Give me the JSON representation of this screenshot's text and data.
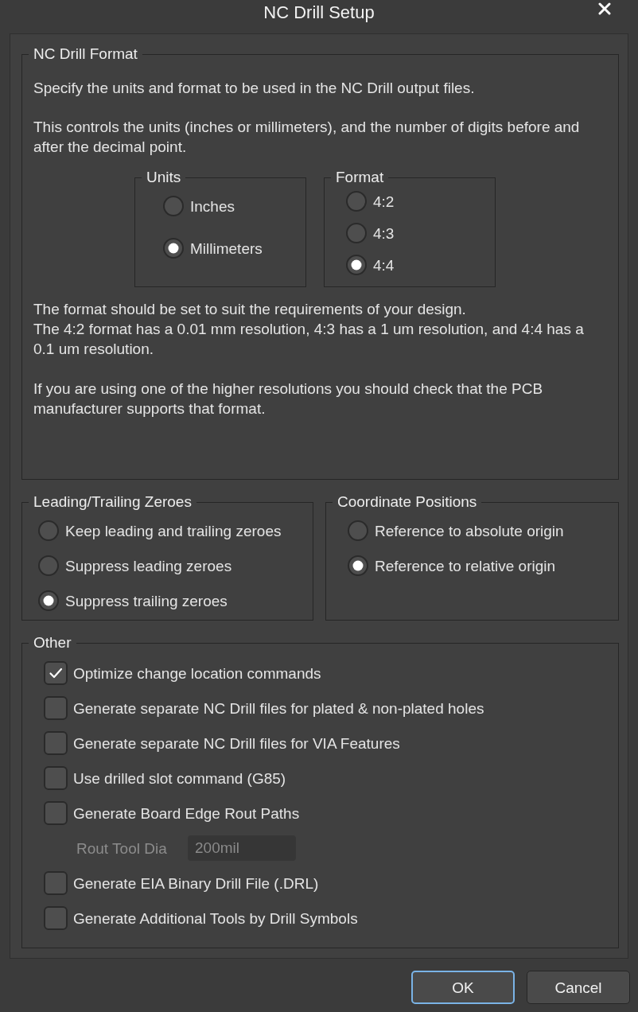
{
  "window": {
    "title": "NC Drill Setup"
  },
  "nc_drill_format": {
    "title": "NC Drill Format",
    "intro": [
      [
        "Specify the units and format to be used in the NC Drill output files."
      ],
      [
        "This controls the units (inches or millimeters), and the number of digits before and after the decimal point."
      ]
    ],
    "units": {
      "title": "Units",
      "options": [
        {
          "label": "Inches",
          "selected": false
        },
        {
          "label": "Millimeters",
          "selected": true
        }
      ]
    },
    "format": {
      "title": "Format",
      "options": [
        {
          "label": "4:2",
          "selected": false
        },
        {
          "label": "4:3",
          "selected": false
        },
        {
          "label": "4:4",
          "selected": true
        }
      ]
    },
    "notes": [
      [
        "The format should be set to suit the requirements of your design.",
        "The 4:2 format has a 0.01 mm resolution, 4:3 has a 1 um resolution, and 4:4 has a 0.1 um resolution."
      ],
      [
        "If you are using one of the higher resolutions you should check that the PCB manufacturer supports that format."
      ]
    ]
  },
  "leading_trailing_zeroes": {
    "title": "Leading/Trailing Zeroes",
    "options": [
      {
        "label": "Keep leading and trailing zeroes",
        "selected": false
      },
      {
        "label": "Suppress leading zeroes",
        "selected": false
      },
      {
        "label": "Suppress trailing zeroes",
        "selected": true
      }
    ]
  },
  "coordinate_positions": {
    "title": "Coordinate Positions",
    "options": [
      {
        "label": "Reference to absolute origin",
        "selected": false
      },
      {
        "label": "Reference to relative origin",
        "selected": true
      }
    ]
  },
  "other": {
    "title": "Other",
    "items": [
      {
        "kind": "checkbox",
        "label": "Optimize change location commands",
        "checked": true
      },
      {
        "kind": "checkbox",
        "label": "Generate separate NC Drill files for plated & non-plated holes",
        "checked": false
      },
      {
        "kind": "checkbox",
        "label": "Generate separate NC Drill files for VIA Features",
        "checked": false
      },
      {
        "kind": "checkbox",
        "label": "Use drilled slot command (G85)",
        "checked": false
      },
      {
        "kind": "checkbox",
        "label": "Generate Board Edge Rout Paths",
        "checked": false
      },
      {
        "kind": "field",
        "label": "Rout Tool Dia",
        "value": "200mil",
        "disabled": true
      },
      {
        "kind": "checkbox",
        "label": "Generate EIA Binary Drill File (.DRL)",
        "checked": false
      },
      {
        "kind": "checkbox",
        "label": "Generate Additional Tools by Drill Symbols",
        "checked": false
      }
    ]
  },
  "buttons": [
    {
      "label": "OK",
      "focused": true
    },
    {
      "label": "Cancel",
      "focused": false
    }
  ]
}
